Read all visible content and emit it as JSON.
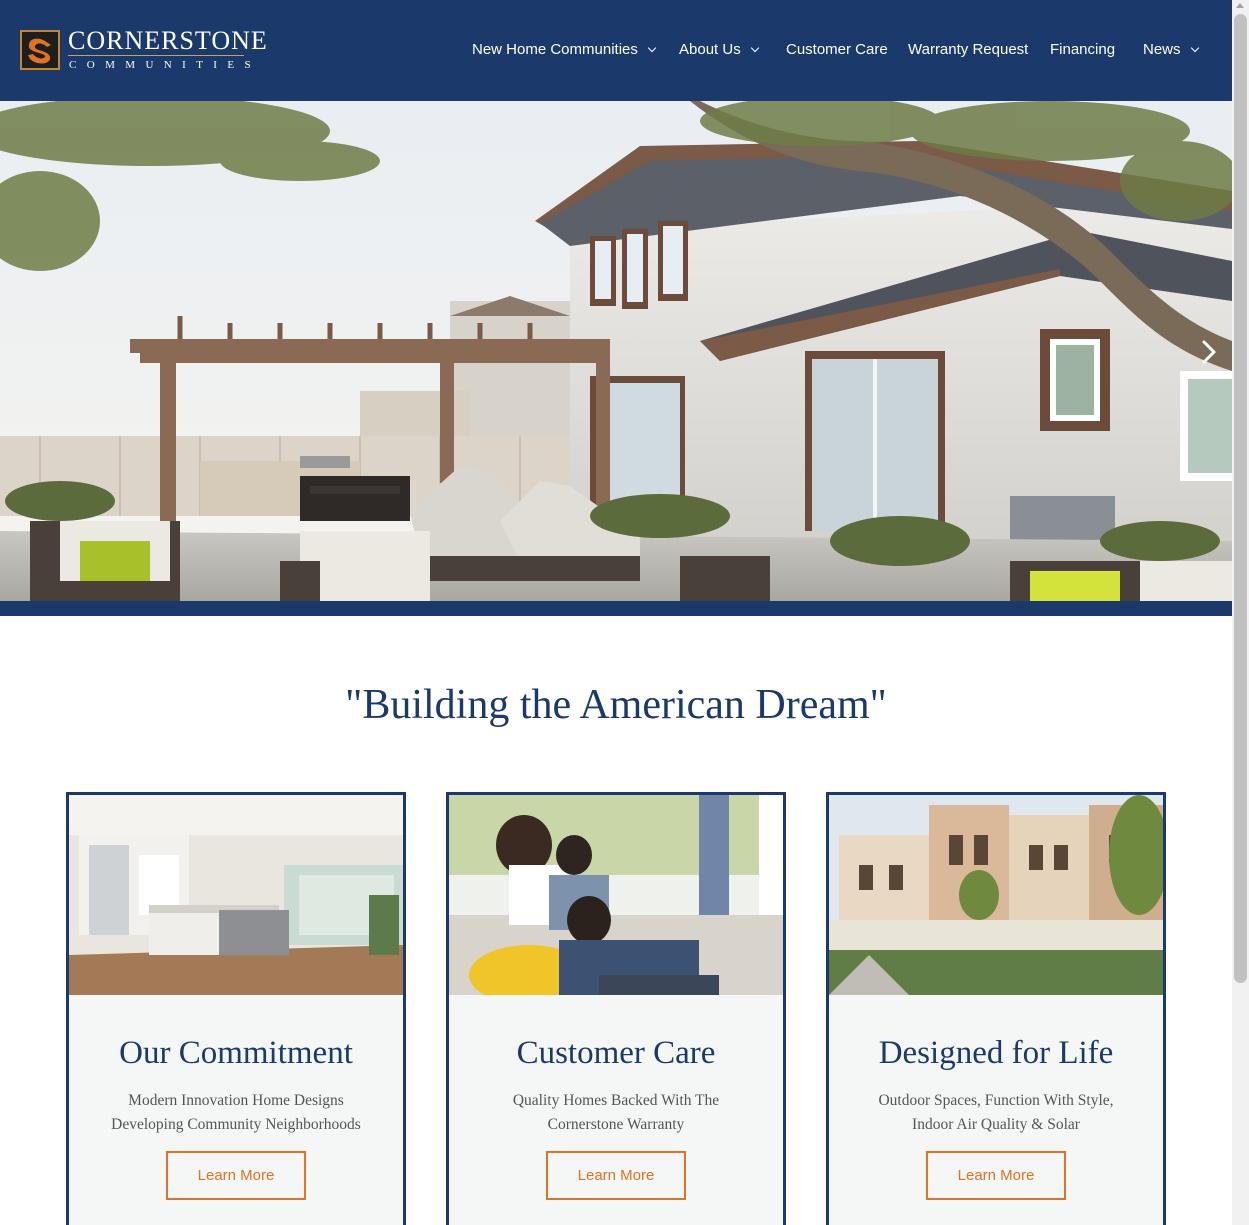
{
  "brand": {
    "name": "CORNERSTONE",
    "sub": "COMMUNITIES",
    "colors": {
      "navy": "#1b3a6b",
      "accent": "#e07222",
      "logo_gold": "#c8842a"
    }
  },
  "nav": {
    "items": [
      {
        "label": "New Home Communities",
        "has_dropdown": true
      },
      {
        "label": "About Us",
        "has_dropdown": true
      },
      {
        "label": "Customer Care",
        "has_dropdown": false
      },
      {
        "label": "Warranty Request",
        "has_dropdown": false
      },
      {
        "label": "Financing",
        "has_dropdown": false
      },
      {
        "label": "News",
        "has_dropdown": true
      }
    ],
    "dropdown_icon": "chevron-down-icon"
  },
  "hero": {
    "next_icon": "chevron-right-icon"
  },
  "tagline": "\"Building the American Dream\"",
  "cards": [
    {
      "title": "Our Commitment",
      "desc_line1": "Modern Innovation Home Designs",
      "desc_line2": "Developing Community Neighborhoods",
      "button": "Learn More"
    },
    {
      "title": "Customer Care",
      "desc_line1": "Quality Homes Backed With The",
      "desc_line2": "Cornerstone Warranty",
      "button": "Learn More"
    },
    {
      "title": "Designed for Life",
      "desc_line1": "Outdoor Spaces, Function With Style,",
      "desc_line2": "Indoor Air Quality & Solar",
      "button": "Learn More"
    }
  ]
}
